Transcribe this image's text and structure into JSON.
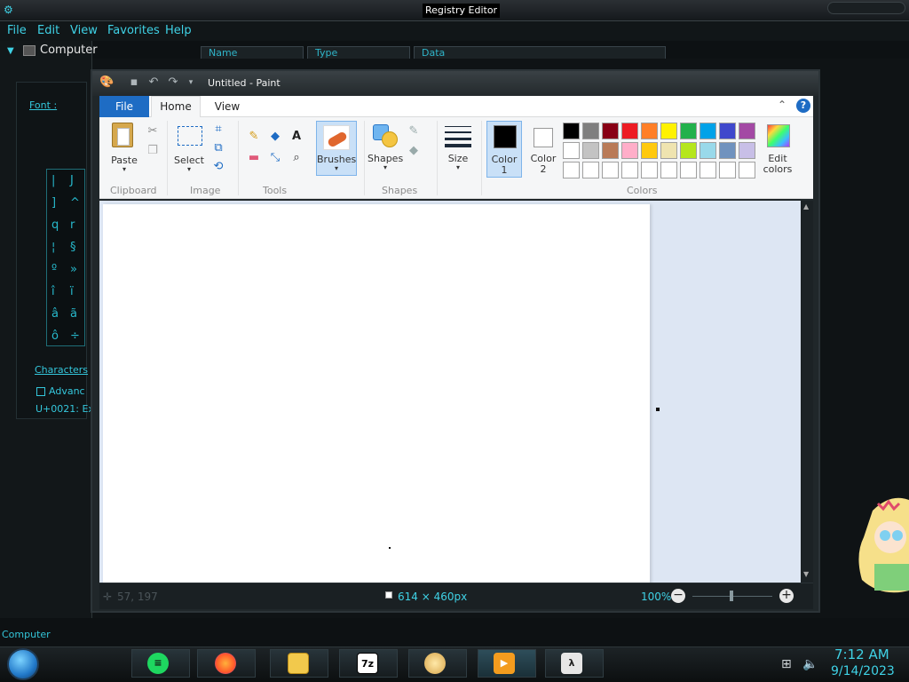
{
  "registry": {
    "title": "Registry Editor",
    "menu": [
      "File",
      "Edit",
      "View",
      "Favorites",
      "Help"
    ],
    "tree_root": "Computer",
    "columns": [
      "Name",
      "Type",
      "Data"
    ],
    "status": "Computer"
  },
  "charmap": {
    "font_label": "Font :",
    "glyphs": [
      "|",
      "J",
      "]",
      "^",
      "q",
      "r",
      "¦",
      "§",
      "º",
      "»",
      "î",
      "ï",
      "â",
      "ã",
      "ô",
      "÷"
    ],
    "characters_label": "Characters",
    "advanced_label": "Advanc",
    "unicode_label": "U+0021: Ex"
  },
  "paint": {
    "title": "Untitled - Paint",
    "tabs": {
      "file": "File",
      "home": "Home",
      "view": "View"
    },
    "groups": {
      "clipboard": "Clipboard",
      "image": "Image",
      "tools": "Tools",
      "shapes": "Shapes",
      "colors": "Colors"
    },
    "buttons": {
      "paste": "Paste",
      "select": "Select",
      "brushes": "Brushes",
      "shapes": "Shapes",
      "size": "Size",
      "color1_a": "Color",
      "color1_b": "1",
      "color2_a": "Color",
      "color2_b": "2",
      "edit_colors_a": "Edit",
      "edit_colors_b": "colors"
    },
    "color1": "#000000",
    "color2": "#ffffff",
    "palette_row1": [
      "#000000",
      "#7f7f7f",
      "#880015",
      "#ed1c24",
      "#ff7f27",
      "#fff200",
      "#22b14c",
      "#00a2e8",
      "#3f48cc",
      "#a349a4"
    ],
    "palette_row2": [
      "#ffffff",
      "#c3c3c3",
      "#b97a57",
      "#ffaec9",
      "#ffc90e",
      "#efe4b0",
      "#b5e61d",
      "#99d9ea",
      "#7092be",
      "#c8bfe7"
    ],
    "status": {
      "cursor_pos": "57, 197",
      "canvas_size": "614 × 460px",
      "zoom": "100%"
    }
  },
  "taskbar": {
    "time": "7:12 AM",
    "date": "9/14/2023",
    "apps": [
      "spotify-icon",
      "firefox-icon",
      "file-explorer-icon",
      "7zip-icon",
      "paint-icon",
      "media-player-icon",
      "lambda-app-icon"
    ]
  }
}
